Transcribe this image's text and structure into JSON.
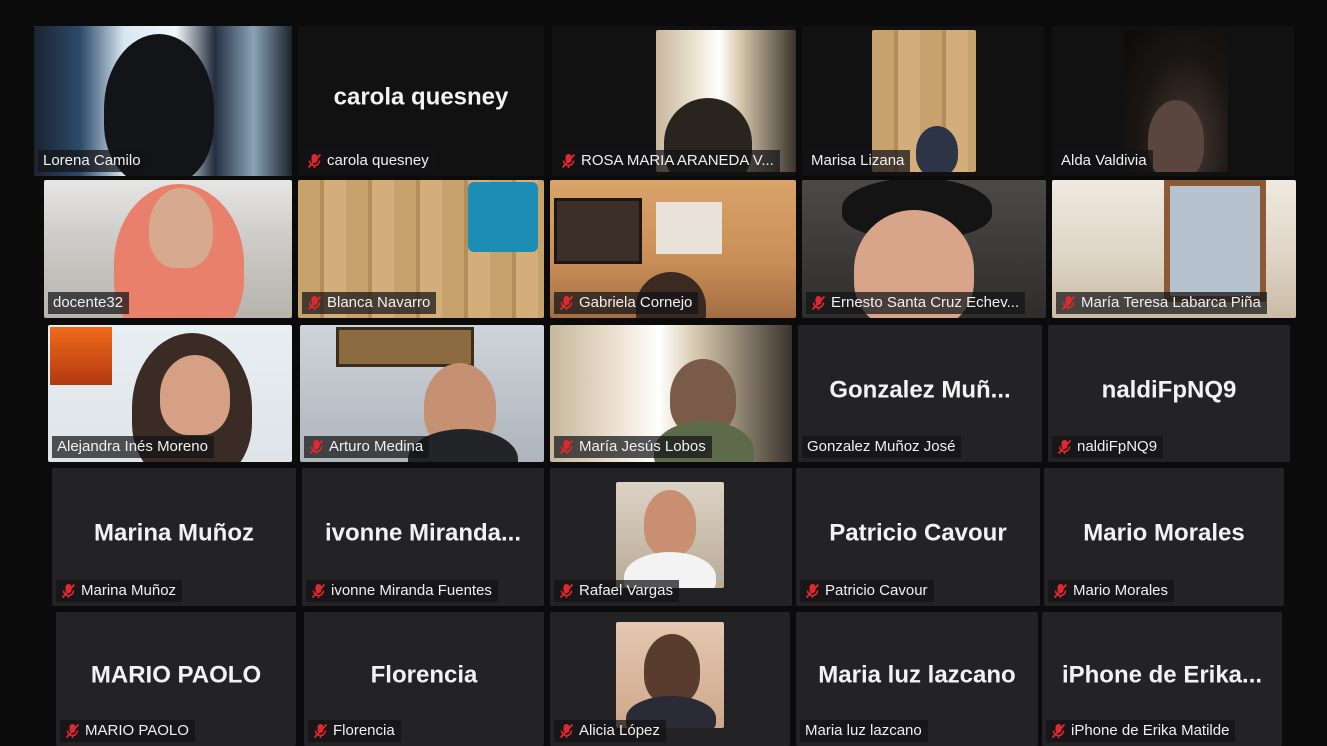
{
  "meeting": {
    "participants": [
      {
        "id": "lorena",
        "label": "Lorena Camilo",
        "muted": false,
        "video": true,
        "active": true
      },
      {
        "id": "carola",
        "label": "carola quesney",
        "display_name": "carola quesney",
        "muted": true,
        "video": false
      },
      {
        "id": "rosa",
        "label": "ROSA MARIA ARANEDA V...",
        "muted": true,
        "video": true
      },
      {
        "id": "marisa",
        "label": "Marisa Lizana",
        "muted": false,
        "video": true
      },
      {
        "id": "alda",
        "label": "Alda Valdivia",
        "muted": false,
        "video": true
      },
      {
        "id": "docente32",
        "label": "docente32",
        "muted": false,
        "video": true
      },
      {
        "id": "blanca",
        "label": "Blanca Navarro",
        "muted": true,
        "video": true
      },
      {
        "id": "gabriela",
        "label": "Gabriela Cornejo",
        "muted": true,
        "video": true
      },
      {
        "id": "ernesto",
        "label": "Ernesto Santa Cruz Echev...",
        "muted": true,
        "video": true
      },
      {
        "id": "mariateresa",
        "label": "María Teresa Labarca Piña",
        "muted": true,
        "video": true
      },
      {
        "id": "alejandra",
        "label": "Alejandra Inés Moreno",
        "muted": false,
        "video": true
      },
      {
        "id": "arturo",
        "label": "Arturo Medina",
        "muted": true,
        "video": true
      },
      {
        "id": "mariajesus",
        "label": "María Jesús Lobos",
        "muted": true,
        "video": true
      },
      {
        "id": "gonzalez",
        "label": "Gonzalez  Muñoz José",
        "display_name": "Gonzalez  Muñ...",
        "muted": false,
        "video": false
      },
      {
        "id": "naldi",
        "label": "naldiFpNQ9",
        "display_name": "naldiFpNQ9",
        "muted": true,
        "video": false
      },
      {
        "id": "marina",
        "label": "Marina Muñoz",
        "display_name": "Marina Muñoz",
        "muted": true,
        "video": false
      },
      {
        "id": "ivonne",
        "label": "ivonne Miranda Fuentes",
        "display_name": "ivonne  Miranda...",
        "muted": true,
        "video": false
      },
      {
        "id": "rafael",
        "label": "Rafael Vargas",
        "muted": true,
        "video": true
      },
      {
        "id": "patricio",
        "label": "Patricio Cavour",
        "display_name": "Patricio Cavour",
        "muted": true,
        "video": false
      },
      {
        "id": "mario",
        "label": "Mario Morales",
        "display_name": "Mario Morales",
        "muted": true,
        "video": false
      },
      {
        "id": "mariopaolo",
        "label": "MARIO PAOLO",
        "display_name": "MARIO PAOLO",
        "muted": true,
        "video": false
      },
      {
        "id": "florencia",
        "label": "Florencia",
        "display_name": "Florencia",
        "muted": true,
        "video": false
      },
      {
        "id": "alicia",
        "label": "Alicia López",
        "muted": true,
        "video": true
      },
      {
        "id": "marialuz",
        "label": "Maria luz lazcano",
        "display_name": "Maria luz lazcano",
        "muted": false,
        "video": false
      },
      {
        "id": "iphone",
        "label": "iPhone de Erika Matilde",
        "display_name": "iPhone de  Erika...",
        "muted": true,
        "video": false
      }
    ]
  },
  "colors": {
    "active_speaker_border": "#b7d838",
    "mute_icon": "#e0282e",
    "tile_bg": "#232325"
  },
  "icons": {
    "muted": "microphone-muted-icon"
  }
}
